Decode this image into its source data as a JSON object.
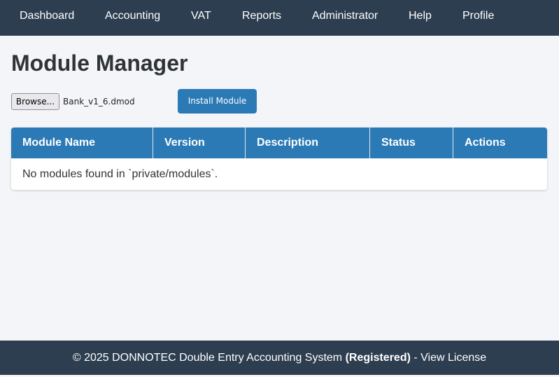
{
  "nav": {
    "items": [
      {
        "label": "Dashboard"
      },
      {
        "label": "Accounting"
      },
      {
        "label": "VAT"
      },
      {
        "label": "Reports"
      },
      {
        "label": "Administrator"
      },
      {
        "label": "Help"
      },
      {
        "label": "Profile"
      }
    ]
  },
  "page": {
    "title": "Module Manager"
  },
  "upload": {
    "browse_label": "Browse...",
    "selected_file": "Bank_v1_6.dmod",
    "install_label": "Install Module"
  },
  "table": {
    "columns": [
      "Module Name",
      "Version",
      "Description",
      "Status",
      "Actions"
    ],
    "empty_message": "No modules found in `private/modules`."
  },
  "footer": {
    "copyright": "© 2025 DONNOTEC Double Entry Accounting System",
    "registered": "(Registered)",
    "separator": "-",
    "license_link": "View License"
  },
  "colors": {
    "nav_bg": "#2d3e50",
    "accent": "#2b7ab6",
    "page_bg": "#f4f5f9"
  }
}
